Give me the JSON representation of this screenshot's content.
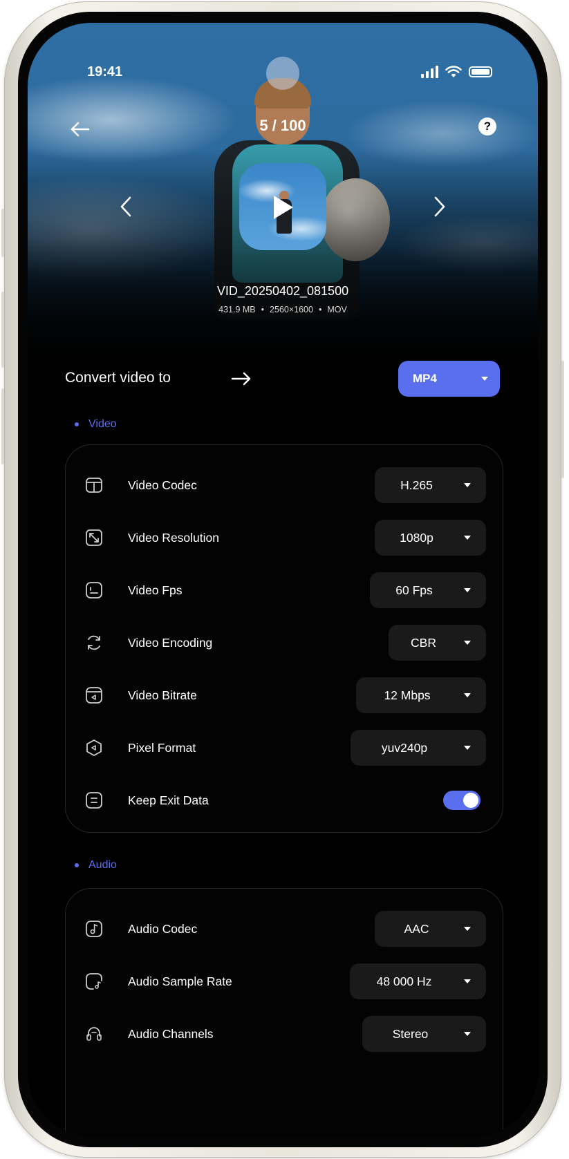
{
  "status_bar": {
    "time": "19:41"
  },
  "header": {
    "counter": "5 / 100",
    "help_symbol": "?"
  },
  "file": {
    "name": "VID_20250402_081500",
    "size": "431.9 MB",
    "resolution": "2560×1600",
    "container": "MOV",
    "separator": "•"
  },
  "convert": {
    "label": "Convert video to",
    "format": "MP4"
  },
  "video": {
    "title": "Video",
    "rows": [
      {
        "label": "Video Codec",
        "value": "H.265",
        "icon": "layout-icon"
      },
      {
        "label": "Video Resolution",
        "value": "1080p",
        "icon": "expand-diagonal-icon"
      },
      {
        "label": "Video Fps",
        "value": "60 Fps",
        "icon": "fps-icon"
      },
      {
        "label": "Video Encoding",
        "value": "CBR",
        "icon": "refresh-icon"
      },
      {
        "label": "Video Bitrate",
        "value": "12 Mbps",
        "icon": "bitrate-icon"
      },
      {
        "label": "Pixel Format",
        "value": "yuv240p",
        "icon": "hexagon-icon"
      }
    ],
    "keep_exit": {
      "label": "Keep Exit Data",
      "enabled": true,
      "icon": "document-icon"
    }
  },
  "audio": {
    "title": "Audio",
    "rows": [
      {
        "label": "Audio Codec",
        "value": "AAC",
        "icon": "music-note-icon"
      },
      {
        "label": "Audio Sample Rate",
        "value": "48 000 Hz",
        "icon": "sample-rate-icon"
      },
      {
        "label": "Audio Channels",
        "value": "Stereo",
        "icon": "headphones-icon"
      }
    ]
  },
  "colors": {
    "accent": "#5a6fee",
    "background": "#000000",
    "control": "#1a1a1a"
  }
}
